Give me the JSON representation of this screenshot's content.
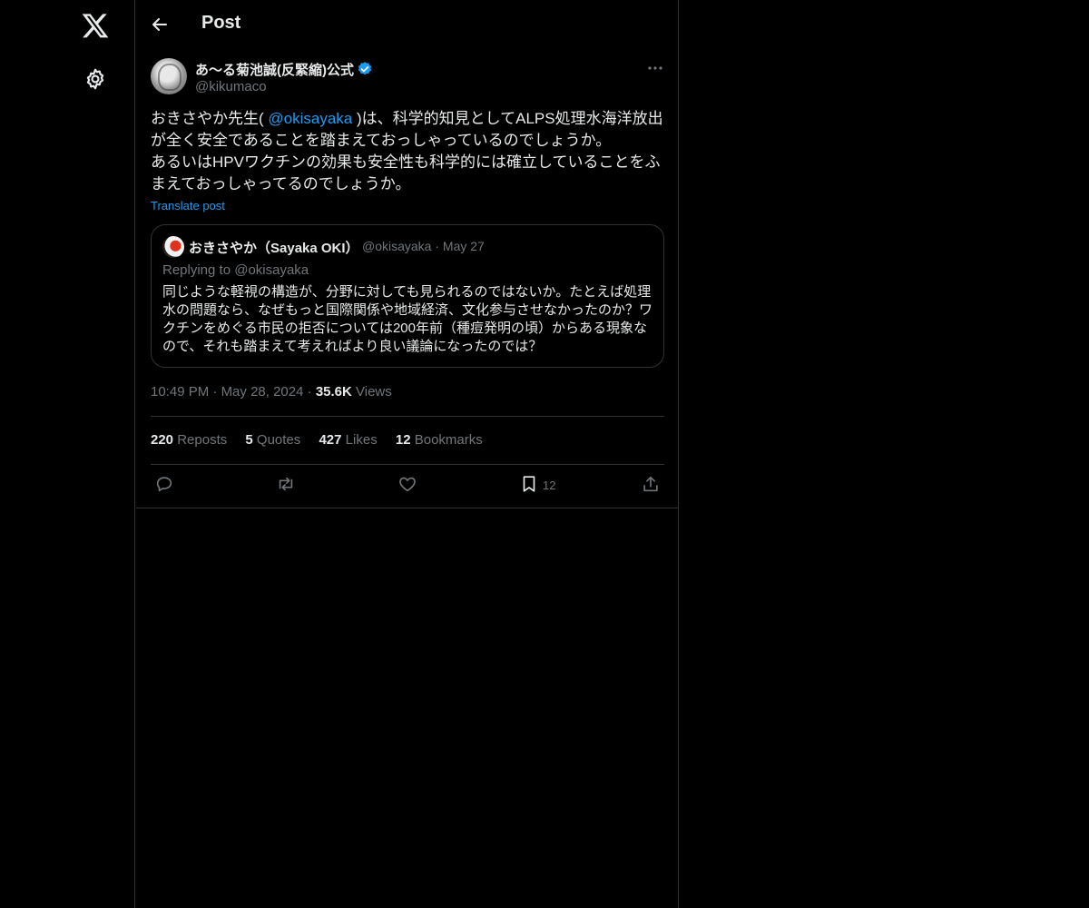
{
  "header": {
    "title": "Post"
  },
  "post": {
    "display_name": "あ〜る菊池誠(反緊縮)公式",
    "handle": "@kikumaco",
    "text_line1_pre": "おきさやか先生( ",
    "text_mention": "@okisayaka",
    "text_line1_post": " )は、科学的知見としてALPS処理水海洋放出が全く安全であることを踏まえておっしゃっているのでしょうか。",
    "text_line2": "あるいはHPVワクチンの効果も安全性も科学的には確立していることをふまえておっしゃってるのでしょうか。",
    "translate": "Translate post",
    "time": "10:49 PM",
    "date": "May 28, 2024",
    "views_count": "35.6K",
    "views_label": "Views",
    "sep": "·"
  },
  "quote": {
    "display_name": "おきさやか（Sayaka OKI）",
    "handle": "@okisayaka",
    "date": "May 27",
    "replying": "Replying to @okisayaka",
    "text": "同じような軽視の構造が、分野に対しても見られるのではないか。たとえば処理水の問題なら、なぜもっと国際関係や地域経済、文化参与させなかったのか？ワクチンをめぐる市民の拒否については200年前（種痘発明の頃）からある現象なので、それも踏まえて考えればより良い議論になったのでは？"
  },
  "stats": {
    "reposts_count": "220",
    "reposts_label": "Reposts",
    "quotes_count": "5",
    "quotes_label": "Quotes",
    "likes_count": "427",
    "likes_label": "Likes",
    "bookmarks_count": "12",
    "bookmarks_label": "Bookmarks"
  },
  "actions": {
    "bookmark_count": "12"
  },
  "icons": {
    "logo": "x-logo-icon",
    "settings": "gear-icon",
    "back": "back-arrow-icon",
    "verified": "verified-badge-icon",
    "more": "more-icon",
    "reply": "reply-icon",
    "repost": "repost-icon",
    "like": "heart-icon",
    "bookmark": "bookmark-icon",
    "share": "share-icon"
  },
  "colors": {
    "background": "#000000",
    "text": "#e7e9ea",
    "muted": "#71767b",
    "accent": "#1d9bf0",
    "border": "#2f3336"
  }
}
